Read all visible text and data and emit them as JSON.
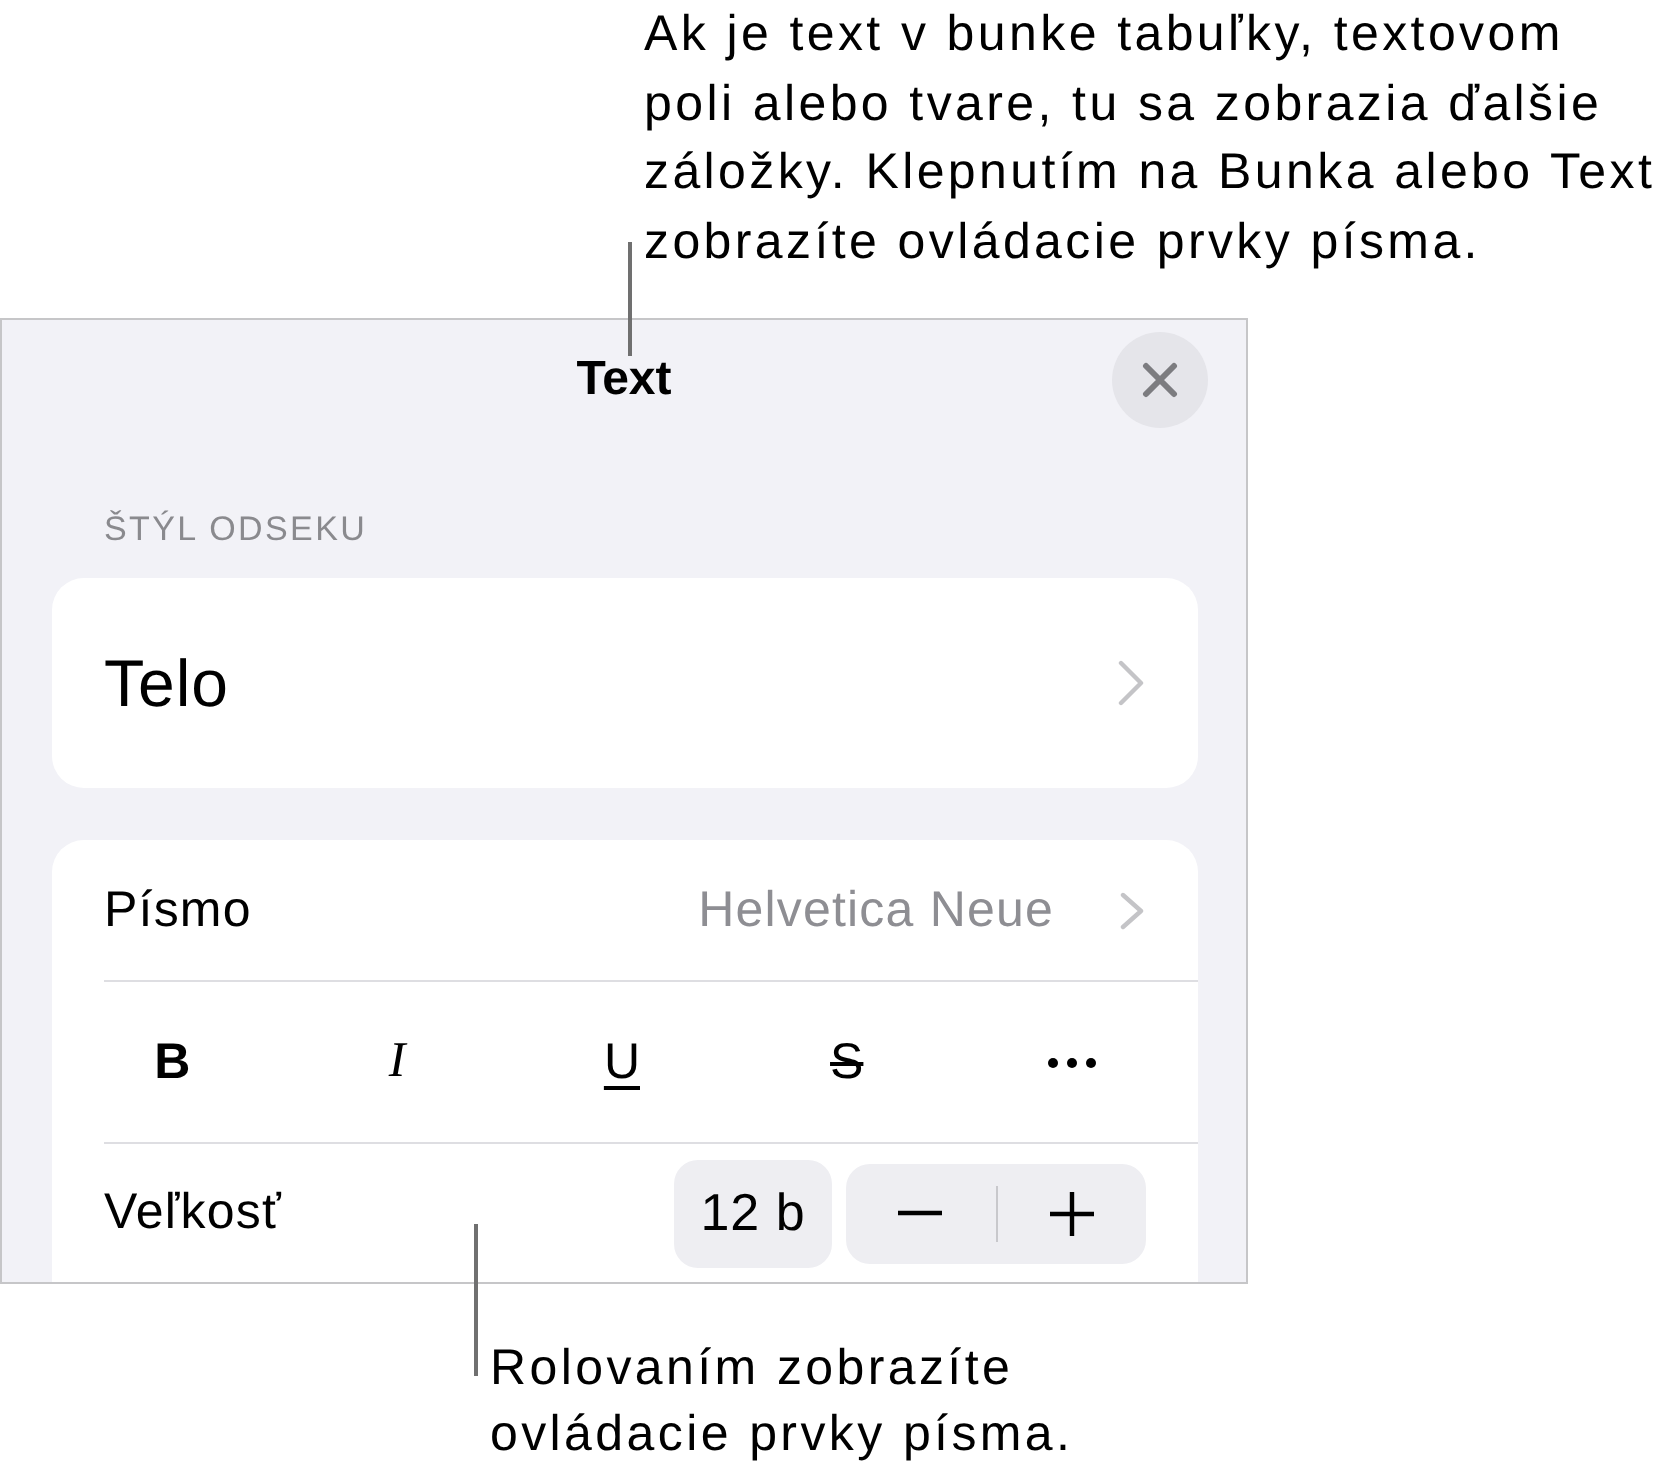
{
  "top_callout": {
    "text": "Ak je text v bunke tabuľky, textovom\npoli alebo tvare, tu sa zobrazia ďalšie\nzáložky. Klepnutím na Bunka alebo Text\nzobrazíte ovládacie prvky písma."
  },
  "panel": {
    "title": "Text",
    "section_header": "ŠTÝL ODSEKU",
    "paragraph_style": "Telo",
    "font_row": {
      "label": "Písmo",
      "value": "Helvetica Neue"
    },
    "format_buttons": [
      {
        "kind": "bold",
        "label": "B",
        "on": false
      },
      {
        "kind": "italic",
        "label": "I",
        "on": false
      },
      {
        "kind": "underline",
        "label": "U",
        "on": false
      },
      {
        "kind": "strikethrough",
        "label": "S",
        "on": false
      },
      {
        "kind": "more",
        "on": false
      }
    ],
    "size_row": {
      "label": "Veľkosť",
      "value": "12 b"
    }
  },
  "bottom_callout": {
    "text": "Rolovaním zobrazíte\novládacie prvky písma."
  }
}
